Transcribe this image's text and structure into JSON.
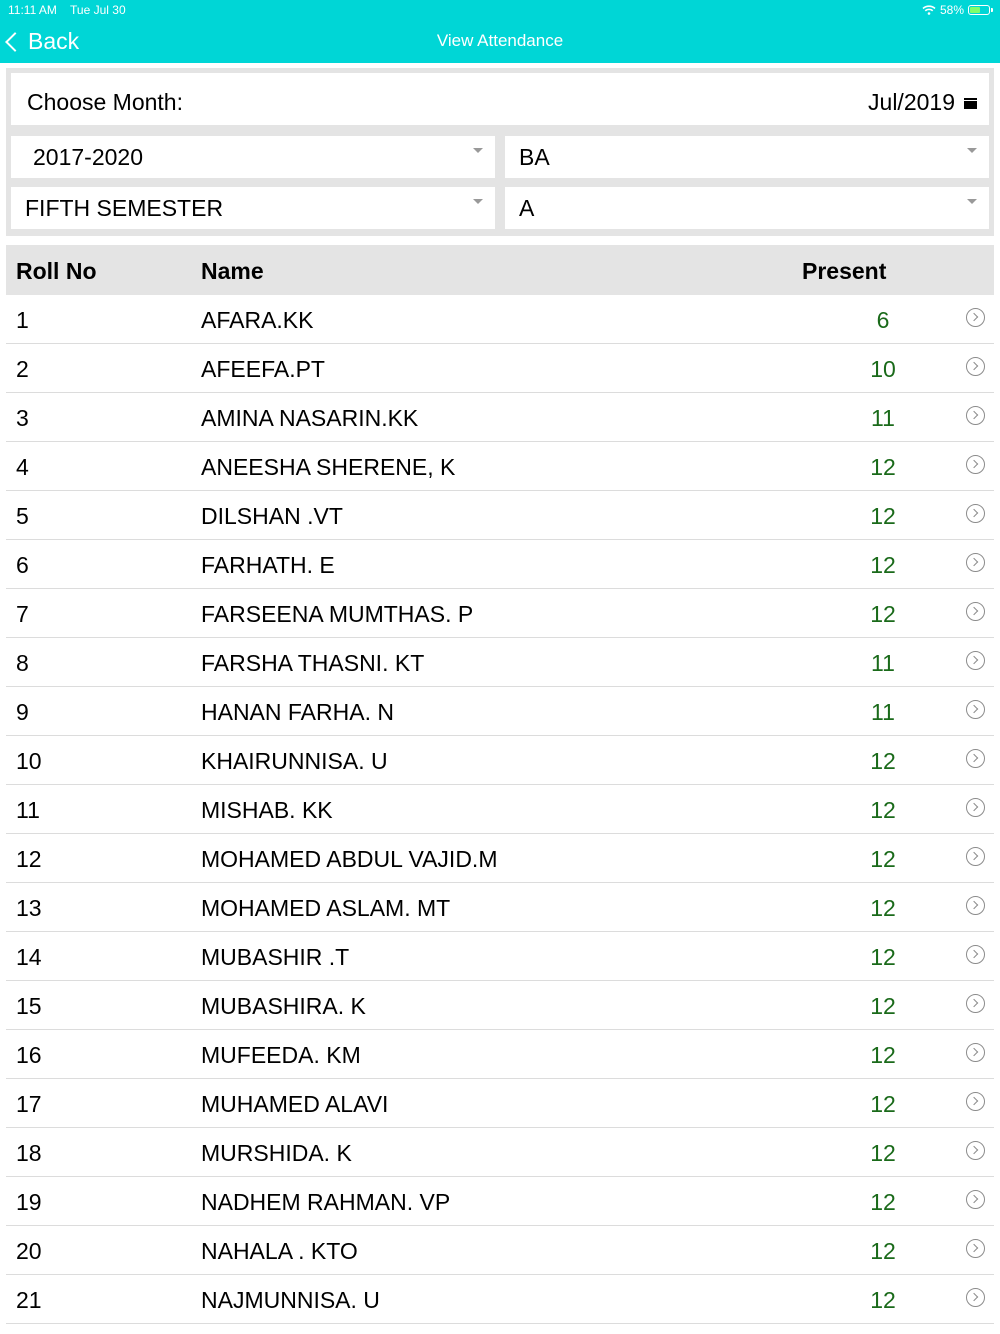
{
  "status_bar": {
    "time": "11:11 AM",
    "date": "Tue Jul 30",
    "battery": "58%",
    "battery_level": 0.58
  },
  "nav": {
    "back_label": "Back",
    "title": "View Attendance"
  },
  "filters": {
    "month_label": "Choose Month:",
    "month_value": "Jul/2019",
    "batch": "2017-2020",
    "course": "BA",
    "semester": "FIFTH SEMESTER",
    "division": "A"
  },
  "table": {
    "headers": {
      "roll": "Roll No",
      "name": "Name",
      "present": "Present"
    },
    "rows": [
      {
        "roll": "1",
        "name": "AFARA.KK",
        "present": "6"
      },
      {
        "roll": "2",
        "name": "AFEEFA.PT",
        "present": "10"
      },
      {
        "roll": "3",
        "name": "AMINA NASARIN.KK",
        "present": "11"
      },
      {
        "roll": "4",
        "name": "ANEESHA SHERENE, K",
        "present": "12"
      },
      {
        "roll": "5",
        "name": "DILSHAN .VT",
        "present": "12"
      },
      {
        "roll": "6",
        "name": "FARHATH. E",
        "present": "12"
      },
      {
        "roll": "7",
        "name": "FARSEENA MUMTHAS. P",
        "present": "12"
      },
      {
        "roll": "8",
        "name": "FARSHA THASNI. KT",
        "present": "11"
      },
      {
        "roll": "9",
        "name": "HANAN FARHA. N",
        "present": "11"
      },
      {
        "roll": "10",
        "name": "KHAIRUNNISA. U",
        "present": "12"
      },
      {
        "roll": "11",
        "name": "MISHAB. KK",
        "present": "12"
      },
      {
        "roll": "12",
        "name": "MOHAMED ABDUL VAJID.M",
        "present": "12"
      },
      {
        "roll": "13",
        "name": "MOHAMED ASLAM. MT",
        "present": "12"
      },
      {
        "roll": "14",
        "name": "MUBASHIR .T",
        "present": "12"
      },
      {
        "roll": "15",
        "name": "MUBASHIRA. K",
        "present": "12"
      },
      {
        "roll": "16",
        "name": "MUFEEDA. KM",
        "present": "12"
      },
      {
        "roll": "17",
        "name": "MUHAMED ALAVI",
        "present": "12"
      },
      {
        "roll": "18",
        "name": "MURSHIDA. K",
        "present": "12"
      },
      {
        "roll": "19",
        "name": "NADHEM RAHMAN. VP",
        "present": "12"
      },
      {
        "roll": "20",
        "name": "NAHALA . KTO",
        "present": "12"
      },
      {
        "roll": "21",
        "name": "NAJMUNNISA. U",
        "present": "12"
      }
    ]
  },
  "colors": {
    "accent": "#00d6d6",
    "present_text": "#1a6a1a",
    "header_bg": "#e4e4e4"
  }
}
